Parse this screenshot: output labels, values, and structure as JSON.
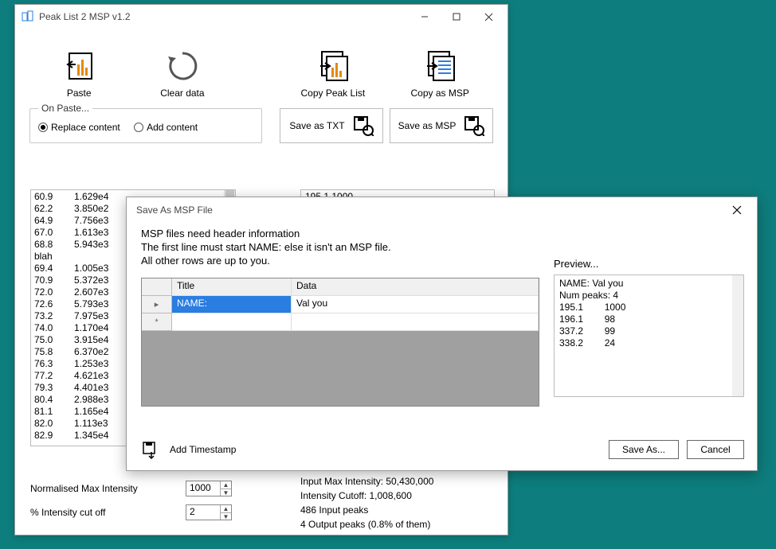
{
  "main": {
    "title": "Peak List 2 MSP v1.2",
    "toolbar": {
      "paste": "Paste",
      "clear": "Clear data",
      "copy_peak": "Copy Peak List",
      "copy_msp": "Copy as MSP"
    },
    "on_paste": {
      "legend": "On Paste...",
      "replace": "Replace content",
      "add": "Add content"
    },
    "save_txt": "Save as TXT",
    "save_msp": "Save as MSP",
    "peak_rows": [
      [
        "60.9",
        "1.629e4"
      ],
      [
        "62.2",
        "3.850e2"
      ],
      [
        "64.9",
        "7.756e3"
      ],
      [
        "67.0",
        "1.613e3"
      ],
      [
        "68.8",
        "5.943e3"
      ],
      [
        "blah",
        ""
      ],
      [
        "69.4",
        "1.005e3"
      ],
      [
        "70.9",
        "5.372e3"
      ],
      [
        "72.0",
        "2.607e3"
      ],
      [
        "72.6",
        "5.793e3"
      ],
      [
        "73.2",
        "7.975e3"
      ],
      [
        "74.0",
        "1.170e4"
      ],
      [
        "75.0",
        "3.915e4"
      ],
      [
        "75.8",
        "6.370e2"
      ],
      [
        "76.3",
        "1.253e3"
      ],
      [
        "77.2",
        "4.621e3"
      ],
      [
        "79.3",
        "4.401e3"
      ],
      [
        "80.4",
        "2.988e3"
      ],
      [
        "81.1",
        "1.165e4"
      ],
      [
        "82.0",
        "1.113e3"
      ],
      [
        "82.9",
        "1.345e4"
      ]
    ],
    "output_row": "195.1     1000",
    "norm_label": "Normalised Max Intensity",
    "norm_val": "1000",
    "cutoff_label": "% Intensity cut off",
    "cutoff_val": "2",
    "stats": {
      "l1": "Input Max Intensity: 50,430,000",
      "l2": "Intensity Cutoff: 1,008,600",
      "l3": "486 Input peaks",
      "l4": "4 Output peaks  (0.8% of them)"
    }
  },
  "dialog": {
    "title": "Save As MSP File",
    "info1": "MSP files need header information",
    "info2": "The first line must start NAME: else it isn't an MSP file.",
    "info3": "All other rows are up to you.",
    "preview_label": "Preview...",
    "grid": {
      "h_title": "Title",
      "h_data": "Data",
      "row1_title": "NAME:",
      "row1_data": "Val you"
    },
    "preview_lines": [
      "NAME: Val you",
      "Num peaks: 4",
      "195.1        1000",
      "196.1        98",
      "337.2        99",
      "338.2        24"
    ],
    "add_timestamp": "Add Timestamp",
    "save_as": "Save As...",
    "cancel": "Cancel"
  }
}
